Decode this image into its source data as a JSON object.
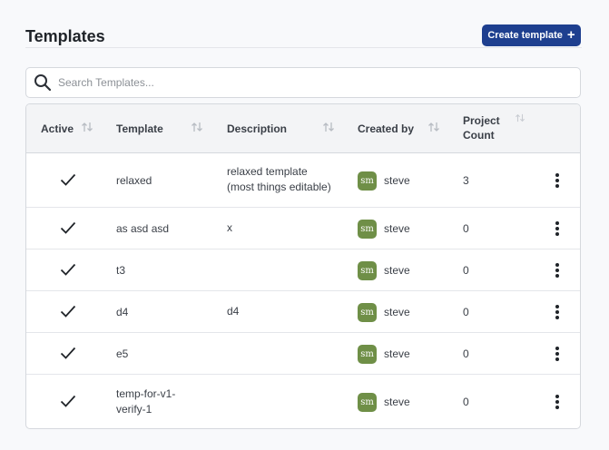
{
  "header": {
    "title": "Templates",
    "create_button_label": "Create template",
    "create_button_icon": "+"
  },
  "search": {
    "placeholder": "Search Templates...",
    "value": ""
  },
  "table": {
    "columns": {
      "active": "Active",
      "template": "Template",
      "description": "Description",
      "created_by": "Created by",
      "project_count_line1": "Project",
      "project_count_line2": "Count"
    },
    "rows": [
      {
        "active": true,
        "template": [
          "relaxed"
        ],
        "description": [
          "relaxed template",
          "(most things editable)"
        ],
        "avatar": "sm",
        "owner": "steve",
        "count": "3"
      },
      {
        "active": true,
        "template": [
          "as asd asd"
        ],
        "description": [
          "x"
        ],
        "avatar": "sm",
        "owner": "steve",
        "count": "0"
      },
      {
        "active": true,
        "template": [
          "t3"
        ],
        "description": [],
        "avatar": "sm",
        "owner": "steve",
        "count": "0"
      },
      {
        "active": true,
        "template": [
          "d4"
        ],
        "description": [
          "d4"
        ],
        "avatar": "sm",
        "owner": "steve",
        "count": "0"
      },
      {
        "active": true,
        "template": [
          "e5"
        ],
        "description": [],
        "avatar": "sm",
        "owner": "steve",
        "count": "0"
      },
      {
        "active": true,
        "template": [
          "temp-for-v1-",
          "verify-1"
        ],
        "description": [],
        "avatar": "sm",
        "owner": "steve",
        "count": "0"
      }
    ]
  },
  "colors": {
    "primary": "#1e3f8f",
    "avatar": "#6f8f47",
    "header_bg": "#f3f4f6"
  },
  "icons": {
    "search": "search-icon",
    "sort": "sort-icon",
    "check": "check-icon",
    "menu": "kebab-menu-icon"
  }
}
